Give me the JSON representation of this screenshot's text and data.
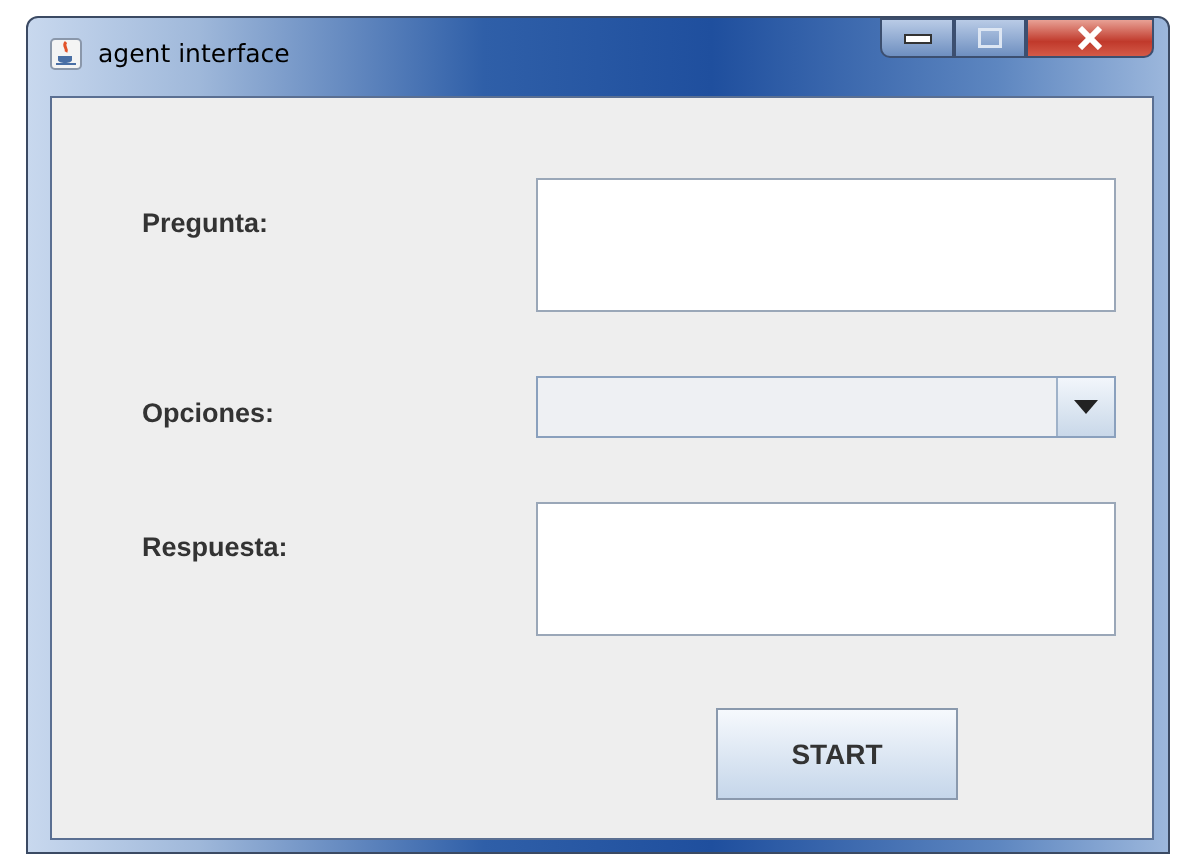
{
  "window": {
    "title": "agent interface"
  },
  "fields": [
    {
      "label": "Pregunta:",
      "kind": "textarea"
    },
    {
      "label": "Opciones:",
      "kind": "combo"
    },
    {
      "label": "Respuesta:",
      "kind": "textarea"
    }
  ],
  "buttons": [
    "START"
  ]
}
